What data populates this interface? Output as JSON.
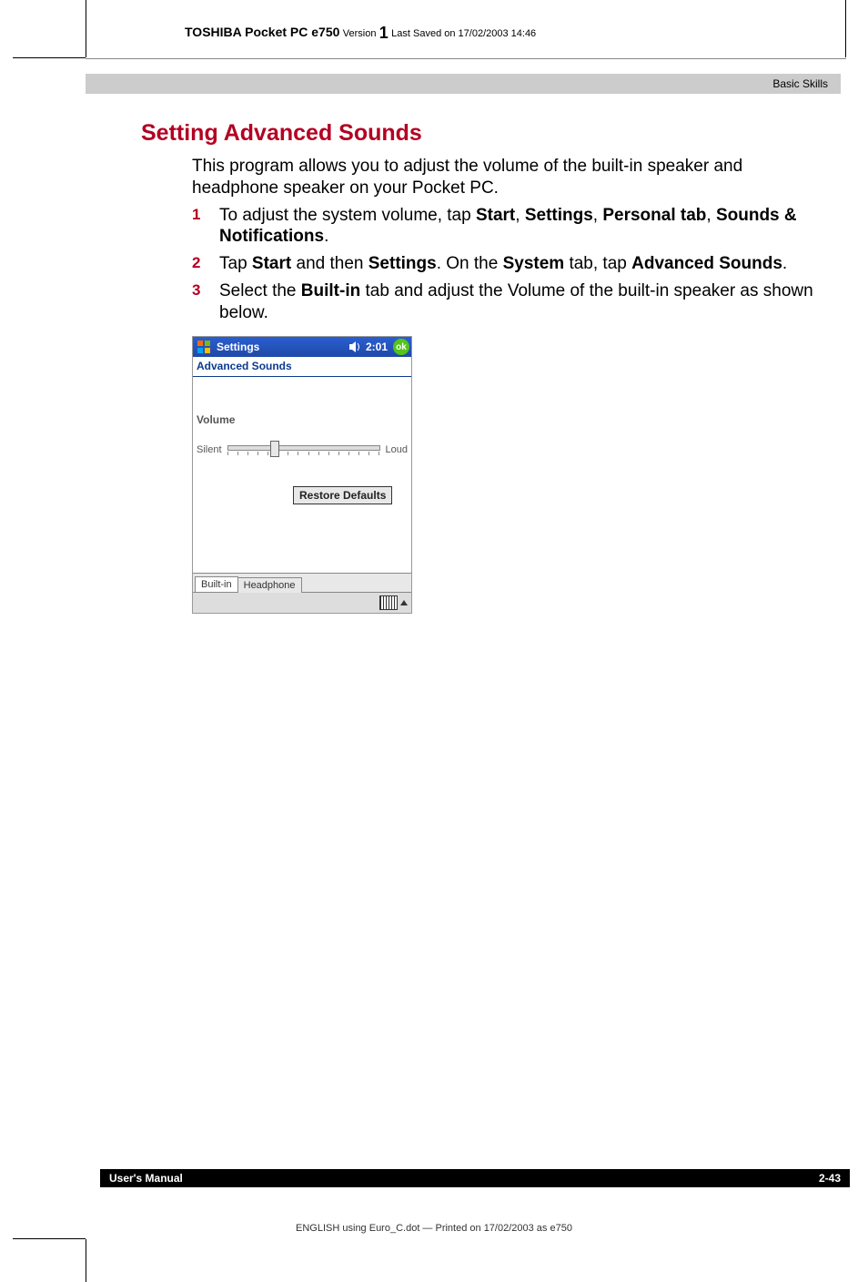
{
  "header": {
    "product": "TOSHIBA Pocket PC e750",
    "version_label": "Version",
    "version_number": "1",
    "saved_label": "Last Saved on 17/02/2003 14:46"
  },
  "section_bar": "Basic Skills",
  "heading": "Setting Advanced Sounds",
  "intro": "This program allows you to adjust the volume of the built-in speaker and headphone speaker on your Pocket PC.",
  "steps": [
    {
      "num": "1",
      "html": "To adjust the system volume, tap <b>Start</b>, <b>Settings</b>, <b>Personal tab</b>, <b>Sounds & Notifications</b>."
    },
    {
      "num": "2",
      "html": "Tap <b>Start</b> and then <b>Settings</b>. On the <b>System</b> tab, tap <b>Advanced Sounds</b>."
    },
    {
      "num": "3",
      "html": "Select the <b>Built-in</b> tab and adjust the Volume of the built-in speaker as shown below."
    }
  ],
  "pda": {
    "title": "Settings",
    "time": "2:01",
    "ok": "ok",
    "subtitle": "Advanced Sounds",
    "volume_label": "Volume",
    "slider_left": "Silent",
    "slider_right": "Loud",
    "restore_btn": "Restore Defaults",
    "tabs": [
      "Built-in",
      "Headphone"
    ],
    "active_tab": 0
  },
  "footer": {
    "left": "User's Manual",
    "right": "2-43",
    "note": "ENGLISH using Euro_C.dot — Printed on 17/02/2003 as e750"
  }
}
